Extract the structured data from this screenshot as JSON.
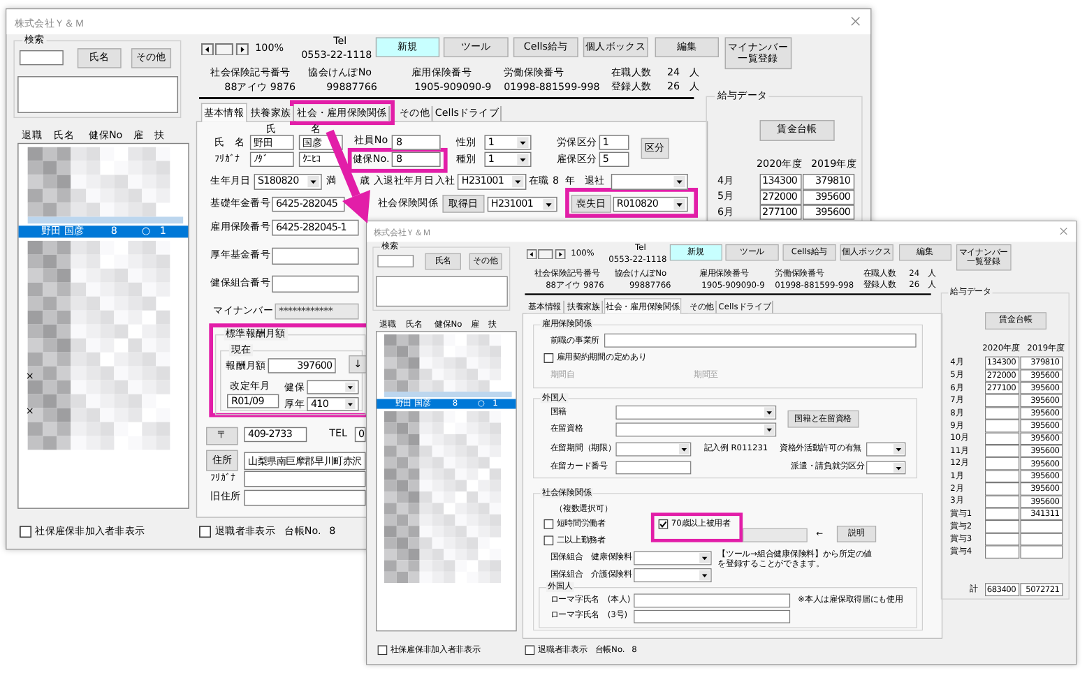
{
  "windows": [
    {
      "title": "株式会社Ｙ＆Ｍ",
      "search": {
        "label": "検索",
        "buttons": [
          "氏名",
          "その他"
        ]
      },
      "list": {
        "columns": [
          "退職",
          "氏名",
          "健保No",
          "雇",
          "扶"
        ],
        "rows": [
          {
            "cells": [
              "",
              "野田 国彦",
              "8",
              "○",
              "1"
            ],
            "selected": true
          }
        ],
        "marks": [
          "×",
          "×"
        ]
      },
      "zoom": "100%",
      "tel": {
        "label": "Tel",
        "value": "0553-22-1118"
      },
      "toolbar": [
        {
          "label": "新規",
          "kind": "primary"
        },
        {
          "label": "ツール",
          "kind": "normal"
        },
        {
          "label": "Cells給与",
          "kind": "normal"
        },
        {
          "label": "個人ボックス",
          "kind": "normal"
        },
        {
          "label": "編集",
          "kind": "normal"
        },
        {
          "lines": [
            "マイナンバー",
            "一覧登録"
          ],
          "kind": "normal"
        }
      ],
      "info": [
        {
          "label": "社会保険記号番号",
          "value": "88アイウ 9876"
        },
        {
          "label": "協会けんぽNo",
          "value": "99887766"
        },
        {
          "label": "雇用保険番号",
          "value": "1905-909090-9"
        },
        {
          "label": "労働保険番号",
          "value": "01998-881599-998"
        }
      ],
      "counts": [
        {
          "label": "在職人数",
          "value": "24",
          "unit": "人"
        },
        {
          "label": "登録人数",
          "value": "26",
          "unit": "人"
        }
      ],
      "tabs": [
        {
          "label": "基本情報",
          "selected": true
        },
        {
          "label": "扶養家族",
          "selected": false
        },
        {
          "label": "社会・雇用保険関係",
          "selected": false
        },
        {
          "label": "その他",
          "selected": false
        },
        {
          "label": "Cellsドライブ",
          "selected": false
        }
      ],
      "panel": {
        "kind": "basic",
        "items": [
          {
            "kind": "label",
            "text": "氏"
          },
          {
            "kind": "label",
            "text": "名"
          },
          {
            "kind": "label",
            "text": "氏　名"
          },
          {
            "kind": "input",
            "value": "野田"
          },
          {
            "kind": "input",
            "value": "国彦"
          },
          {
            "kind": "label",
            "text": "ﾌﾘｶﾞﾅ"
          },
          {
            "kind": "input",
            "value": "ﾉﾀﾞ"
          },
          {
            "kind": "input",
            "value": "ｸﾆﾋｺ"
          },
          {
            "kind": "label",
            "text": "社員No"
          },
          {
            "kind": "input",
            "value": "8"
          },
          {
            "kind": "label",
            "text": "健保No."
          },
          {
            "kind": "input",
            "value": "8"
          },
          {
            "kind": "label",
            "text": "性別"
          },
          {
            "kind": "dropdown",
            "value": "1"
          },
          {
            "kind": "label",
            "text": "種別"
          },
          {
            "kind": "dropdown",
            "value": "1"
          },
          {
            "kind": "label",
            "text": "労保区分"
          },
          {
            "kind": "input",
            "value": "1"
          },
          {
            "kind": "label",
            "text": "雇保区分"
          },
          {
            "kind": "input",
            "value": "5"
          },
          {
            "kind": "button",
            "label": "区分"
          },
          {
            "kind": "label",
            "text": "生年月日"
          },
          {
            "kind": "dropdown",
            "value": "S180820"
          },
          {
            "kind": "label",
            "text": "満"
          },
          {
            "kind": "label",
            "text": "歳"
          },
          {
            "kind": "label",
            "text": "入退社年月日"
          },
          {
            "kind": "label",
            "text": "入社"
          },
          {
            "kind": "dropdown",
            "value": "H231001"
          },
          {
            "kind": "label",
            "text": "在職"
          },
          {
            "kind": "label",
            "text": "8"
          },
          {
            "kind": "label",
            "text": "年"
          },
          {
            "kind": "label",
            "text": "退社"
          },
          {
            "kind": "dropdown"
          },
          {
            "kind": "label",
            "text": "基礎年金番号"
          },
          {
            "kind": "input",
            "value": "6425-282045"
          },
          {
            "kind": "label",
            "text": "社会保険関係"
          },
          {
            "kind": "button",
            "label": "取得日"
          },
          {
            "kind": "dropdown",
            "value": "H231001"
          },
          {
            "kind": "button",
            "label": "喪失日"
          },
          {
            "kind": "dropdown",
            "value": "R010820"
          },
          {
            "kind": "label",
            "text": "雇用保険番号"
          },
          {
            "kind": "input",
            "value": "6425-282045-1"
          },
          {
            "kind": "label",
            "text": "厚年基金番号"
          },
          {
            "kind": "input"
          },
          {
            "kind": "label",
            "text": "健保組合番号"
          },
          {
            "kind": "input"
          },
          {
            "kind": "label",
            "text": "マイナンバー"
          },
          {
            "kind": "input",
            "value": "************",
            "disabled": true
          },
          {
            "kind": "frame",
            "legend": "標準報酬月額"
          },
          {
            "kind": "frame",
            "legend": "現在"
          },
          {
            "kind": "label",
            "text": "報酬月額"
          },
          {
            "kind": "number",
            "value": "397600"
          },
          {
            "kind": "button",
            "label": "↓"
          },
          {
            "kind": "label",
            "text": "改定年月"
          },
          {
            "kind": "input",
            "value": "R01/09"
          },
          {
            "kind": "label",
            "text": "健保"
          },
          {
            "kind": "dropdown"
          },
          {
            "kind": "label",
            "text": "厚年"
          },
          {
            "kind": "dropdown",
            "value": "410"
          },
          {
            "kind": "button",
            "label": "〒"
          },
          {
            "kind": "input",
            "value": "409-2733"
          },
          {
            "kind": "label",
            "text": "TEL"
          },
          {
            "kind": "input",
            "value": "0"
          },
          {
            "kind": "button",
            "label": "住所"
          },
          {
            "kind": "input",
            "value": "山梨県南巨摩郡早川町赤沢"
          },
          {
            "kind": "label",
            "text": "ﾌﾘｶﾞﾅ"
          },
          {
            "kind": "input"
          },
          {
            "kind": "label",
            "text": "旧住所"
          },
          {
            "kind": "input"
          }
        ]
      },
      "salary": {
        "label": "給与データ",
        "button": "賃金台帳",
        "years": [
          "2020年度",
          "2019年度"
        ],
        "rows": [
          {
            "month": "4月",
            "current": "134300",
            "previous": "379810"
          },
          {
            "month": "5月",
            "current": "272000",
            "previous": "395600"
          },
          {
            "month": "6月",
            "current": "277100",
            "previous": "395600"
          }
        ]
      },
      "footer": {
        "checkboxes": [
          {
            "label": "社保雇保非加入者非表示",
            "checked": false
          },
          {
            "label": "退職者非表示",
            "checked": false
          }
        ],
        "ledger_label": "台帳No.",
        "ledger_no": "8"
      }
    },
    {
      "title": "株式会社Ｙ＆Ｍ",
      "search": {
        "label": "検索",
        "buttons": [
          "氏名",
          "その他"
        ]
      },
      "list": {
        "columns": [
          "退職",
          "氏名",
          "健保No",
          "雇",
          "扶"
        ],
        "rows": [
          {
            "cells": [
              "",
              "野田 国彦",
              "8",
              "○",
              "1"
            ],
            "selected": true
          }
        ]
      },
      "zoom": "100%",
      "tel": {
        "label": "Tel",
        "value": "0553-22-1118"
      },
      "toolbar": [
        {
          "label": "新規",
          "kind": "primary"
        },
        {
          "label": "ツール",
          "kind": "normal"
        },
        {
          "label": "Cells給与",
          "kind": "normal"
        },
        {
          "label": "個人ボックス",
          "kind": "normal"
        },
        {
          "label": "編集",
          "kind": "normal"
        },
        {
          "lines": [
            "マイナンバー",
            "一覧登録"
          ],
          "kind": "normal"
        }
      ],
      "info": [
        {
          "label": "社会保険記号番号",
          "value": "88アイウ 9876"
        },
        {
          "label": "協会けんぽNo",
          "value": "99887766"
        },
        {
          "label": "雇用保険番号",
          "value": "1905-909090-9"
        },
        {
          "label": "労働保険番号",
          "value": "01998-881599-998"
        }
      ],
      "counts": [
        {
          "label": "在職人数",
          "value": "24",
          "unit": "人"
        },
        {
          "label": "登録人数",
          "value": "26",
          "unit": "人"
        }
      ],
      "tabs": [
        {
          "label": "基本情報",
          "selected": false
        },
        {
          "label": "扶養家族",
          "selected": false
        },
        {
          "label": "社会・雇用保険関係",
          "selected": true
        },
        {
          "label": "その他",
          "selected": false
        },
        {
          "label": "Cellsドライブ",
          "selected": false
        }
      ],
      "panel": {
        "kind": "social",
        "items": [
          {
            "kind": "frame",
            "legend": "雇用保険関係"
          },
          {
            "kind": "label",
            "text": "前職の事業所"
          },
          {
            "kind": "input"
          },
          {
            "kind": "checkbox",
            "label": "雇用契約期間の定めあり",
            "checked": false
          },
          {
            "kind": "label",
            "text": "期間自",
            "disabled": true
          },
          {
            "kind": "label",
            "text": "期間至",
            "disabled": true
          },
          {
            "kind": "frame",
            "legend": "外国人"
          },
          {
            "kind": "label",
            "text": "国籍"
          },
          {
            "kind": "dropdown"
          },
          {
            "kind": "label",
            "text": "在留資格"
          },
          {
            "kind": "dropdown"
          },
          {
            "kind": "button",
            "label": "国籍と在留資格"
          },
          {
            "kind": "label",
            "text": "在留期間（期限）"
          },
          {
            "kind": "dropdown"
          },
          {
            "kind": "label",
            "text": "記入例 R011231"
          },
          {
            "kind": "label",
            "text": "資格外活動許可の有無"
          },
          {
            "kind": "dropdown"
          },
          {
            "kind": "label",
            "text": "在留カード番号"
          },
          {
            "kind": "input"
          },
          {
            "kind": "label",
            "text": "派遣・請負就労区分"
          },
          {
            "kind": "dropdown"
          },
          {
            "kind": "frame",
            "legend": "社会保険関係"
          },
          {
            "kind": "label",
            "text": "（複数選択可）"
          },
          {
            "kind": "checkbox",
            "label": "短時間労働者",
            "checked": false
          },
          {
            "kind": "checkbox",
            "label": "二以上勤務者",
            "checked": false
          },
          {
            "kind": "checkbox",
            "label": "70歳以上被用者",
            "checked": true
          },
          {
            "kind": "input",
            "disabled": true
          },
          {
            "kind": "label",
            "text": "←"
          },
          {
            "kind": "button",
            "label": "説明"
          },
          {
            "kind": "label",
            "text": "国保組合　健康保険料"
          },
          {
            "kind": "dropdown"
          },
          {
            "kind": "label",
            "text": "国保組合　介護保険料"
          },
          {
            "kind": "dropdown"
          },
          {
            "kind": "label",
            "text": "【ツール→組合健康保険料】から所定の値"
          },
          {
            "kind": "label",
            "text": "を登録することができます。"
          },
          {
            "kind": "frame",
            "legend": "外国人"
          },
          {
            "kind": "label",
            "text": "ローマ字氏名　(本人)"
          },
          {
            "kind": "input"
          },
          {
            "kind": "label",
            "text": "ローマ字氏名　(3号)"
          },
          {
            "kind": "input"
          },
          {
            "kind": "label",
            "text": "※本人は雇保取得届にも使用"
          }
        ]
      },
      "salary": {
        "label": "給与データ",
        "button": "賃金台帳",
        "years": [
          "2020年度",
          "2019年度"
        ],
        "rows": [
          {
            "month": "4月",
            "current": "134300",
            "previous": "379810"
          },
          {
            "month": "5月",
            "current": "272000",
            "previous": "395600"
          },
          {
            "month": "6月",
            "current": "277100",
            "previous": "395600"
          },
          {
            "month": "7月",
            "previous": "395600"
          },
          {
            "month": "8月",
            "previous": "395600"
          },
          {
            "month": "9月",
            "previous": "395600"
          },
          {
            "month": "10月",
            "previous": "395600"
          },
          {
            "month": "11月",
            "previous": "395600"
          },
          {
            "month": "12月",
            "previous": "395600"
          },
          {
            "month": "1月",
            "previous": "395600"
          },
          {
            "month": "2月",
            "previous": "395600"
          },
          {
            "month": "3月",
            "previous": "395600"
          },
          {
            "month": "賞与1",
            "previous": "341311"
          },
          {
            "month": "賞与2"
          },
          {
            "month": "賞与3"
          },
          {
            "month": "賞与4"
          }
        ],
        "total": {
          "label": "計",
          "current": "683400",
          "previous": "5072721"
        }
      },
      "footer": {
        "checkboxes": [
          {
            "label": "社保雇保非加入者非表示",
            "checked": false
          },
          {
            "label": "退職者非表示",
            "checked": false
          }
        ],
        "ledger_label": "台帳No.",
        "ledger_no": "8"
      }
    }
  ]
}
